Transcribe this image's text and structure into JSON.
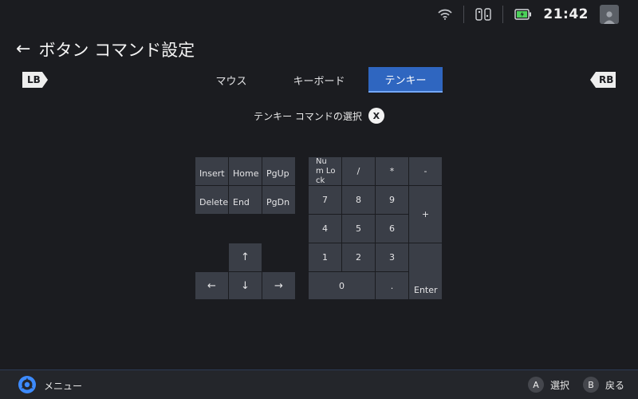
{
  "status": {
    "time": "21:42"
  },
  "header": {
    "back_icon": "←",
    "title": "ボタン コマンド設定"
  },
  "tabs": {
    "lb": "LB",
    "rb": "RB",
    "items": [
      {
        "label": "マウス",
        "active": false
      },
      {
        "label": "キーボード",
        "active": false
      },
      {
        "label": "テンキー",
        "active": true
      }
    ]
  },
  "subtitle": {
    "text": "テンキー コマンドの選択",
    "button": "X"
  },
  "nav_keys": {
    "insert": "Insert",
    "home": "Home",
    "pgup": "PgUp",
    "delete": "Delete",
    "end": "End",
    "pgdn": "PgDn",
    "up": "↑",
    "left": "←",
    "down": "↓",
    "right": "→"
  },
  "numpad": {
    "numlock": "Nu\nm Lo\nck",
    "divide": "/",
    "multiply": "*",
    "minus": "-",
    "k7": "7",
    "k8": "8",
    "k9": "9",
    "plus": "+",
    "k4": "4",
    "k5": "5",
    "k6": "6",
    "k1": "1",
    "k2": "2",
    "k3": "3",
    "enter": "Enter",
    "k0": "0",
    "dot": "."
  },
  "footer": {
    "menu": "メニュー",
    "hint_a": {
      "button": "A",
      "label": "選択"
    },
    "hint_b": {
      "button": "B",
      "label": "戻る"
    }
  },
  "colors": {
    "background": "#1b1c20",
    "key": "#3a3e47",
    "accent": "#2f66c0",
    "battery": "#4cd05a"
  }
}
